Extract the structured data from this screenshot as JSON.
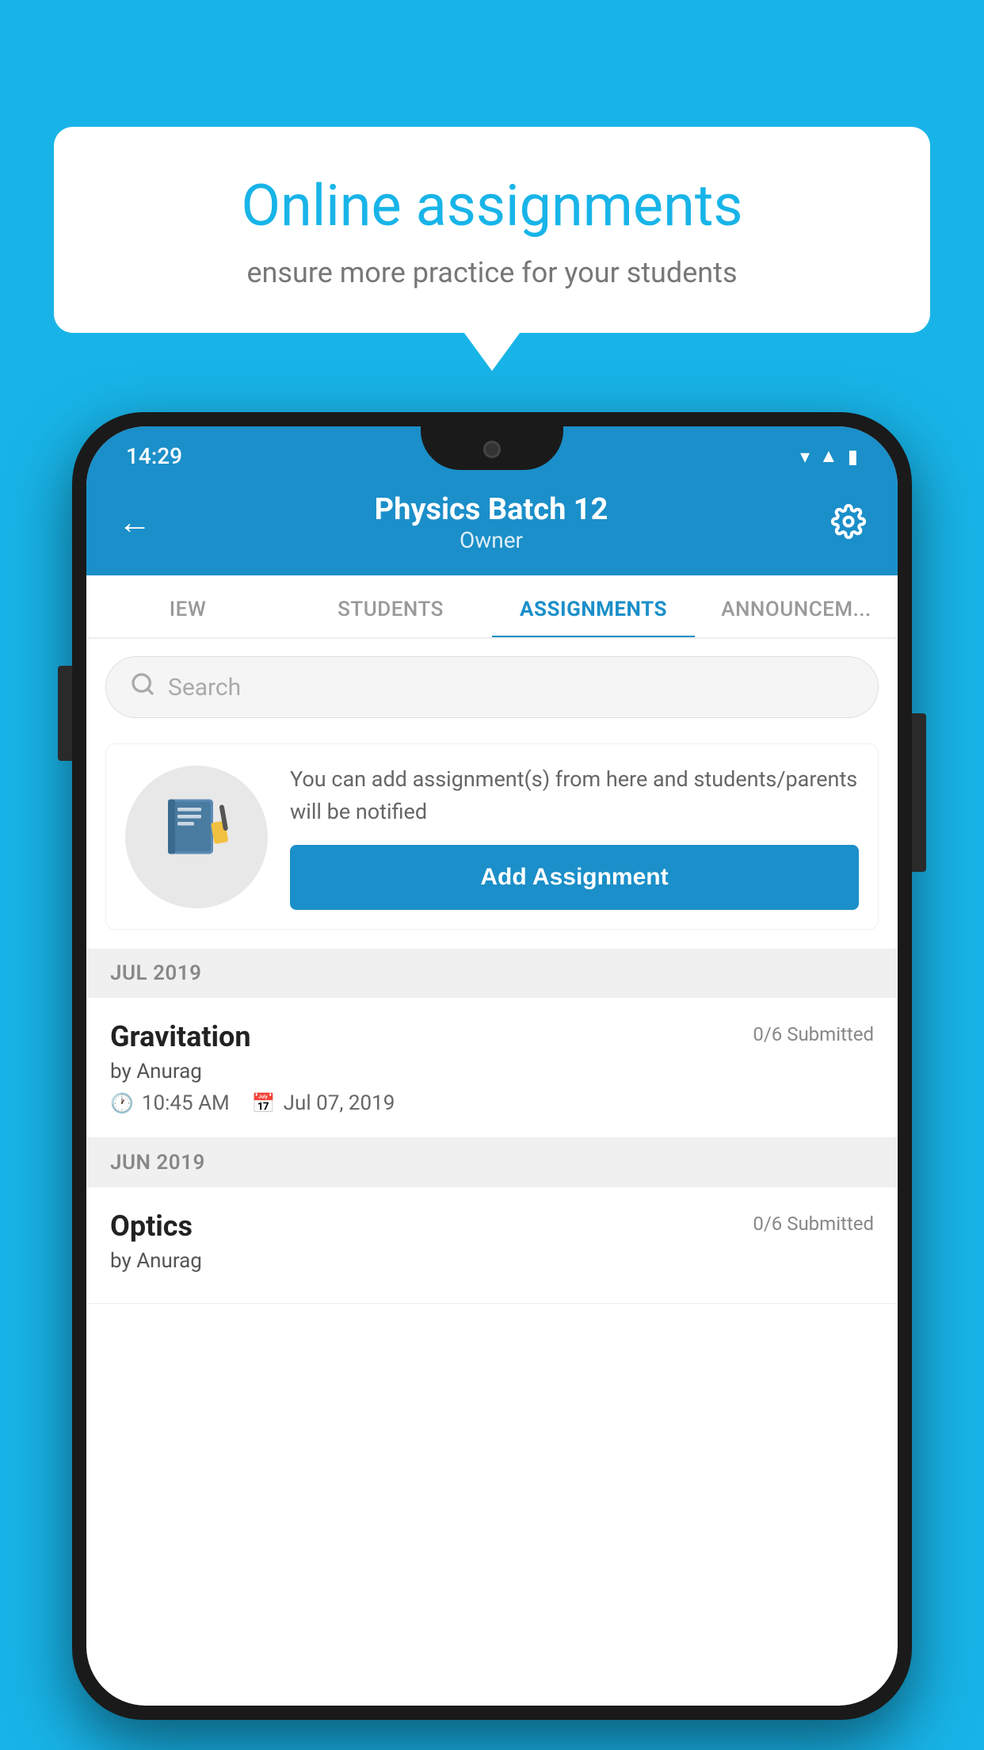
{
  "background_color": "#18B4E8",
  "speech_bubble": {
    "title": "Online assignments",
    "subtitle": "ensure more practice for your students"
  },
  "phone": {
    "status_bar": {
      "time": "14:29",
      "icons": [
        "wifi",
        "signal",
        "battery"
      ]
    },
    "header": {
      "back_label": "←",
      "title": "Physics Batch 12",
      "subtitle": "Owner",
      "settings_label": "⚙"
    },
    "tabs": [
      {
        "label": "IEW",
        "active": false
      },
      {
        "label": "STUDENTS",
        "active": false
      },
      {
        "label": "ASSIGNMENTS",
        "active": true
      },
      {
        "label": "ANNOUNCEM...",
        "active": false
      }
    ],
    "search": {
      "placeholder": "Search"
    },
    "promo": {
      "description": "You can add assignment(s) from here and students/parents will be notified",
      "button_label": "Add Assignment"
    },
    "sections": [
      {
        "month": "JUL 2019",
        "assignments": [
          {
            "name": "Gravitation",
            "submitted": "0/6 Submitted",
            "by": "by Anurag",
            "time": "10:45 AM",
            "date": "Jul 07, 2019"
          }
        ]
      },
      {
        "month": "JUN 2019",
        "assignments": [
          {
            "name": "Optics",
            "submitted": "0/6 Submitted",
            "by": "by Anurag",
            "time": "",
            "date": ""
          }
        ]
      }
    ]
  }
}
